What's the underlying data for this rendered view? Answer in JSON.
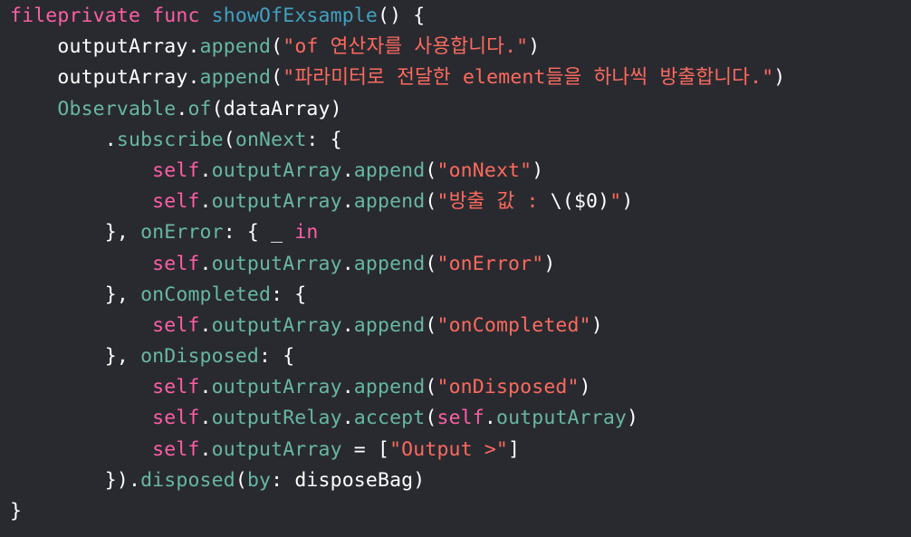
{
  "colors": {
    "background": "#292a30",
    "keyword": "#fc5fa3",
    "string": "#fc6a5d",
    "plain": "#ffffff",
    "function_call": "#67b7a4",
    "declaration": "#41a1c0"
  },
  "code": {
    "lines": [
      {
        "indent": "",
        "tokens": [
          {
            "t": "fileprivate",
            "c": "kw"
          },
          {
            "t": " ",
            "c": "pl"
          },
          {
            "t": "func",
            "c": "kw"
          },
          {
            "t": " ",
            "c": "pl"
          },
          {
            "t": "showOfExsample",
            "c": "decl"
          },
          {
            "t": "() {",
            "c": "pl"
          }
        ]
      },
      {
        "indent": "    ",
        "tokens": [
          {
            "t": "outputArray",
            "c": "pl"
          },
          {
            "t": ".",
            "c": "pl"
          },
          {
            "t": "append",
            "c": "fn"
          },
          {
            "t": "(",
            "c": "pl"
          },
          {
            "t": "\"of 연산자를 사용합니다.\"",
            "c": "str"
          },
          {
            "t": ")",
            "c": "pl"
          }
        ]
      },
      {
        "indent": "    ",
        "tokens": [
          {
            "t": "outputArray",
            "c": "pl"
          },
          {
            "t": ".",
            "c": "pl"
          },
          {
            "t": "append",
            "c": "fn"
          },
          {
            "t": "(",
            "c": "pl"
          },
          {
            "t": "\"파라미터로 전달한 element들을 하나씩 방출합니다.\"",
            "c": "str"
          },
          {
            "t": ")",
            "c": "pl"
          }
        ]
      },
      {
        "indent": "    ",
        "tokens": [
          {
            "t": "Observable",
            "c": "fn"
          },
          {
            "t": ".",
            "c": "pl"
          },
          {
            "t": "of",
            "c": "fn"
          },
          {
            "t": "(dataArray)",
            "c": "pl"
          }
        ]
      },
      {
        "indent": "        ",
        "tokens": [
          {
            "t": ".",
            "c": "pl"
          },
          {
            "t": "subscribe",
            "c": "fn"
          },
          {
            "t": "(",
            "c": "pl"
          },
          {
            "t": "onNext",
            "c": "fn"
          },
          {
            "t": ": {",
            "c": "pl"
          }
        ]
      },
      {
        "indent": "            ",
        "tokens": [
          {
            "t": "self",
            "c": "kw"
          },
          {
            "t": ".",
            "c": "pl"
          },
          {
            "t": "outputArray",
            "c": "fn"
          },
          {
            "t": ".",
            "c": "pl"
          },
          {
            "t": "append",
            "c": "fn"
          },
          {
            "t": "(",
            "c": "pl"
          },
          {
            "t": "\"onNext\"",
            "c": "str"
          },
          {
            "t": ")",
            "c": "pl"
          }
        ]
      },
      {
        "indent": "            ",
        "tokens": [
          {
            "t": "self",
            "c": "kw"
          },
          {
            "t": ".",
            "c": "pl"
          },
          {
            "t": "outputArray",
            "c": "fn"
          },
          {
            "t": ".",
            "c": "pl"
          },
          {
            "t": "append",
            "c": "fn"
          },
          {
            "t": "(",
            "c": "pl"
          },
          {
            "t": "\"방출 값 : ",
            "c": "str"
          },
          {
            "t": "\\($0)",
            "c": "pl"
          },
          {
            "t": "\"",
            "c": "str"
          },
          {
            "t": ")",
            "c": "pl"
          }
        ]
      },
      {
        "indent": "        ",
        "tokens": [
          {
            "t": "}, ",
            "c": "pl"
          },
          {
            "t": "onError",
            "c": "fn"
          },
          {
            "t": ": { _ ",
            "c": "pl"
          },
          {
            "t": "in",
            "c": "kw"
          }
        ]
      },
      {
        "indent": "            ",
        "tokens": [
          {
            "t": "self",
            "c": "kw"
          },
          {
            "t": ".",
            "c": "pl"
          },
          {
            "t": "outputArray",
            "c": "fn"
          },
          {
            "t": ".",
            "c": "pl"
          },
          {
            "t": "append",
            "c": "fn"
          },
          {
            "t": "(",
            "c": "pl"
          },
          {
            "t": "\"onError\"",
            "c": "str"
          },
          {
            "t": ")",
            "c": "pl"
          }
        ]
      },
      {
        "indent": "        ",
        "tokens": [
          {
            "t": "}, ",
            "c": "pl"
          },
          {
            "t": "onCompleted",
            "c": "fn"
          },
          {
            "t": ": {",
            "c": "pl"
          }
        ]
      },
      {
        "indent": "            ",
        "tokens": [
          {
            "t": "self",
            "c": "kw"
          },
          {
            "t": ".",
            "c": "pl"
          },
          {
            "t": "outputArray",
            "c": "fn"
          },
          {
            "t": ".",
            "c": "pl"
          },
          {
            "t": "append",
            "c": "fn"
          },
          {
            "t": "(",
            "c": "pl"
          },
          {
            "t": "\"onCompleted\"",
            "c": "str"
          },
          {
            "t": ")",
            "c": "pl"
          }
        ]
      },
      {
        "indent": "        ",
        "tokens": [
          {
            "t": "}, ",
            "c": "pl"
          },
          {
            "t": "onDisposed",
            "c": "fn"
          },
          {
            "t": ": {",
            "c": "pl"
          }
        ]
      },
      {
        "indent": "            ",
        "tokens": [
          {
            "t": "self",
            "c": "kw"
          },
          {
            "t": ".",
            "c": "pl"
          },
          {
            "t": "outputArray",
            "c": "fn"
          },
          {
            "t": ".",
            "c": "pl"
          },
          {
            "t": "append",
            "c": "fn"
          },
          {
            "t": "(",
            "c": "pl"
          },
          {
            "t": "\"onDisposed\"",
            "c": "str"
          },
          {
            "t": ")",
            "c": "pl"
          }
        ]
      },
      {
        "indent": "            ",
        "tokens": [
          {
            "t": "self",
            "c": "kw"
          },
          {
            "t": ".",
            "c": "pl"
          },
          {
            "t": "outputRelay",
            "c": "fn"
          },
          {
            "t": ".",
            "c": "pl"
          },
          {
            "t": "accept",
            "c": "fn"
          },
          {
            "t": "(",
            "c": "pl"
          },
          {
            "t": "self",
            "c": "kw"
          },
          {
            "t": ".",
            "c": "pl"
          },
          {
            "t": "outputArray",
            "c": "fn"
          },
          {
            "t": ")",
            "c": "pl"
          }
        ]
      },
      {
        "indent": "            ",
        "tokens": [
          {
            "t": "self",
            "c": "kw"
          },
          {
            "t": ".",
            "c": "pl"
          },
          {
            "t": "outputArray",
            "c": "fn"
          },
          {
            "t": " = [",
            "c": "pl"
          },
          {
            "t": "\"Output >\"",
            "c": "str"
          },
          {
            "t": "]",
            "c": "pl"
          }
        ]
      },
      {
        "indent": "        ",
        "tokens": [
          {
            "t": "}).",
            "c": "pl"
          },
          {
            "t": "disposed",
            "c": "fn"
          },
          {
            "t": "(",
            "c": "pl"
          },
          {
            "t": "by",
            "c": "fn"
          },
          {
            "t": ": disposeBag)",
            "c": "pl"
          }
        ]
      },
      {
        "indent": "",
        "tokens": [
          {
            "t": "}",
            "c": "pl"
          }
        ]
      }
    ]
  }
}
